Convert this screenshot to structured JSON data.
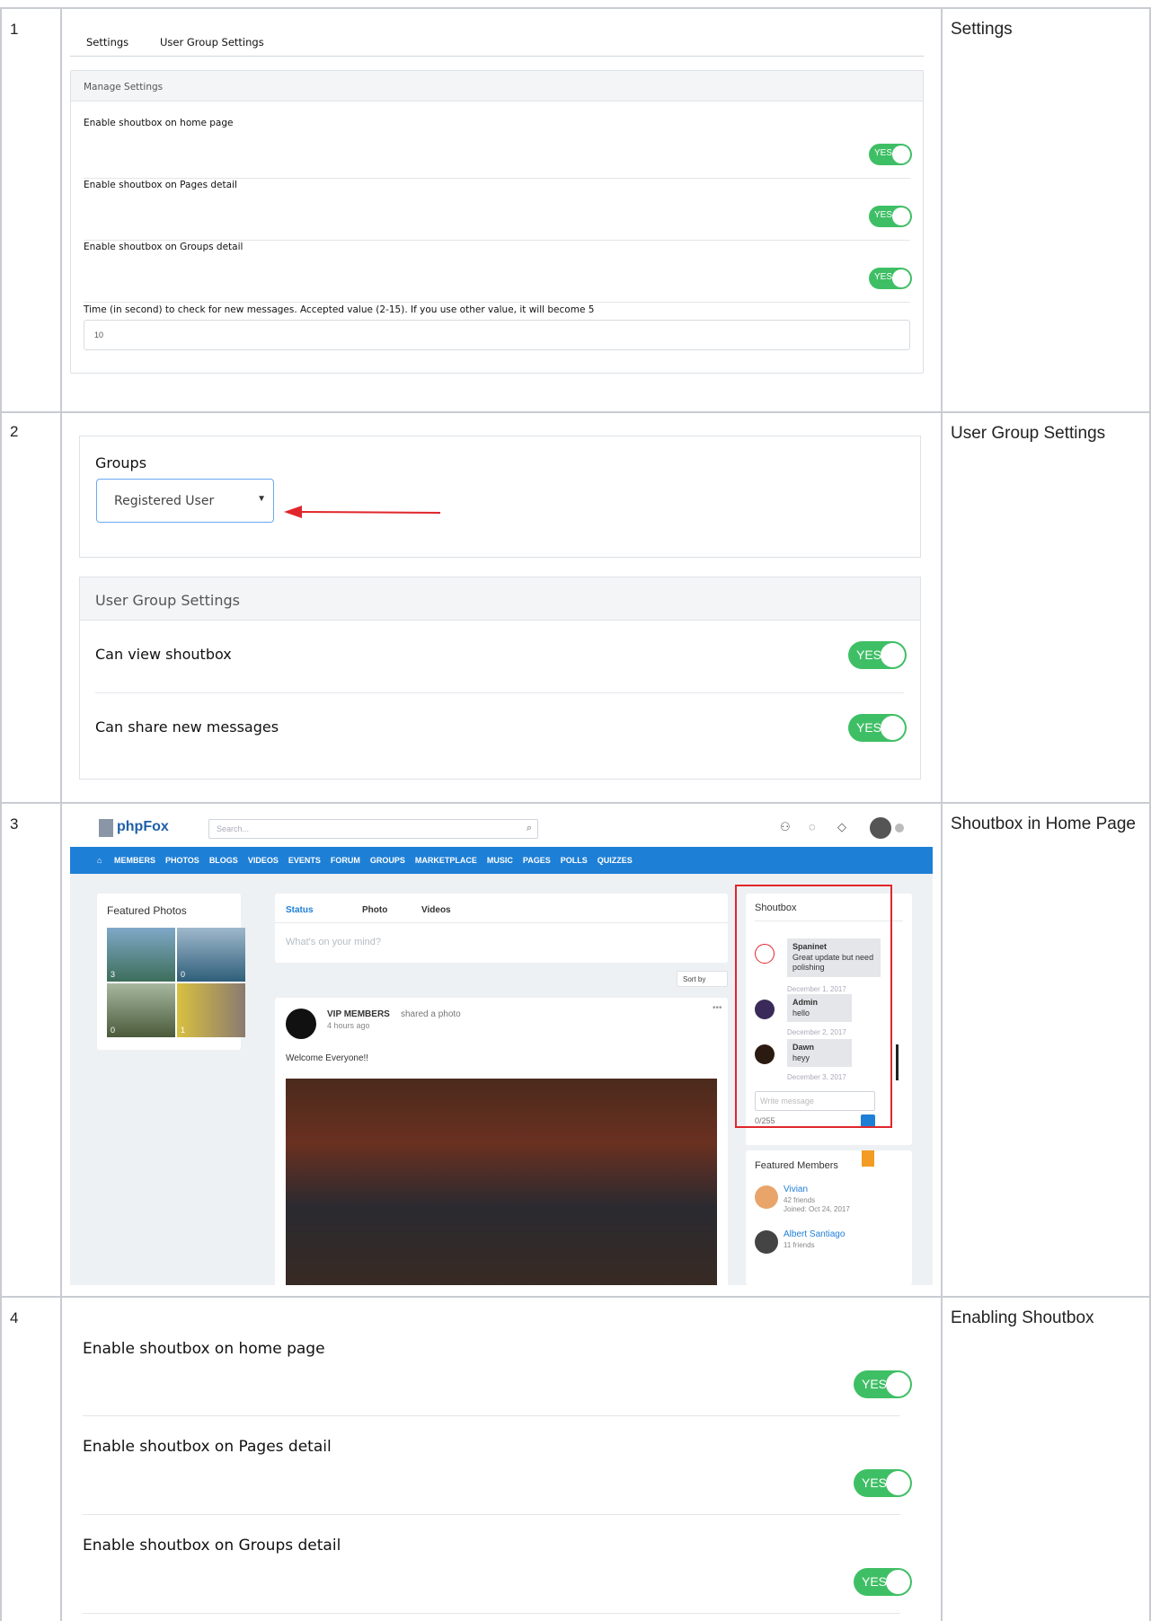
{
  "rows": [
    {
      "num": "1",
      "caption": "Settings"
    },
    {
      "num": "2",
      "caption": "User Group Settings"
    },
    {
      "num": "3",
      "caption": "Shoutbox in Home Page"
    },
    {
      "num": "4",
      "caption": "Enabling Shoutbox"
    }
  ],
  "shot1": {
    "tabs": [
      "Settings",
      "User Group Settings"
    ],
    "panel_title": "Manage Settings",
    "settings": [
      {
        "label": "Enable shoutbox on home page",
        "toggle": "YES"
      },
      {
        "label": "Enable shoutbox on Pages detail",
        "toggle": "YES"
      },
      {
        "label": "Enable shoutbox on Groups detail",
        "toggle": "YES"
      }
    ],
    "time_label": "Time (in second) to check for new messages. Accepted value (2-15). If you use other value, it will become 5",
    "time_value": "10"
  },
  "shot2": {
    "groups_label": "Groups",
    "group_selected": "Registered User",
    "panel_title": "User Group Settings",
    "settings": [
      {
        "label": "Can view shoutbox",
        "toggle": "YES"
      },
      {
        "label": "Can share new messages",
        "toggle": "YES"
      }
    ]
  },
  "shot3": {
    "brand": "phpFox",
    "search_placeholder": "Search...",
    "nav": [
      "MEMBERS",
      "PHOTOS",
      "BLOGS",
      "VIDEOS",
      "EVENTS",
      "FORUM",
      "GROUPS",
      "MARKETPLACE",
      "MUSIC",
      "PAGES",
      "POLLS",
      "QUIZZES"
    ],
    "featured_photos_title": "Featured Photos",
    "photo_counts": [
      "3",
      "0",
      "0",
      "1"
    ],
    "composer_tabs": [
      "Status",
      "Photo",
      "Videos"
    ],
    "composer_placeholder": "What's on your mind?",
    "sort_label": "Sort by",
    "post": {
      "author": "VIP MEMBERS",
      "action": "shared a photo",
      "time": "4 hours ago",
      "text": "Welcome Everyone!!"
    },
    "shoutbox_title": "Shoutbox",
    "messages": [
      {
        "name": "Spaninet",
        "text": "Great update but need polishing",
        "date": "December 1, 2017"
      },
      {
        "name": "Admin",
        "text": "hello",
        "date": "December 2, 2017"
      },
      {
        "name": "Dawn",
        "text": "heyy",
        "date": "December 3, 2017"
      }
    ],
    "message_placeholder": "Write message",
    "char_count": "0/255",
    "featured_members_title": "Featured Members",
    "members": [
      {
        "name": "Vivian",
        "friends": "42 friends",
        "joined": "Joined: Oct 24, 2017"
      },
      {
        "name": "Albert Santiago",
        "friends": "11 friends"
      }
    ],
    "colors": {
      "accent": "#1e7fd6",
      "toggle": "#3fbf65",
      "highlight": "#e0262b"
    }
  },
  "shot4": {
    "settings": [
      {
        "label": "Enable shoutbox on home page",
        "toggle": "YES"
      },
      {
        "label": "Enable shoutbox on Pages detail",
        "toggle": "YES"
      },
      {
        "label": "Enable shoutbox on Groups detail",
        "toggle": "YES"
      }
    ]
  }
}
